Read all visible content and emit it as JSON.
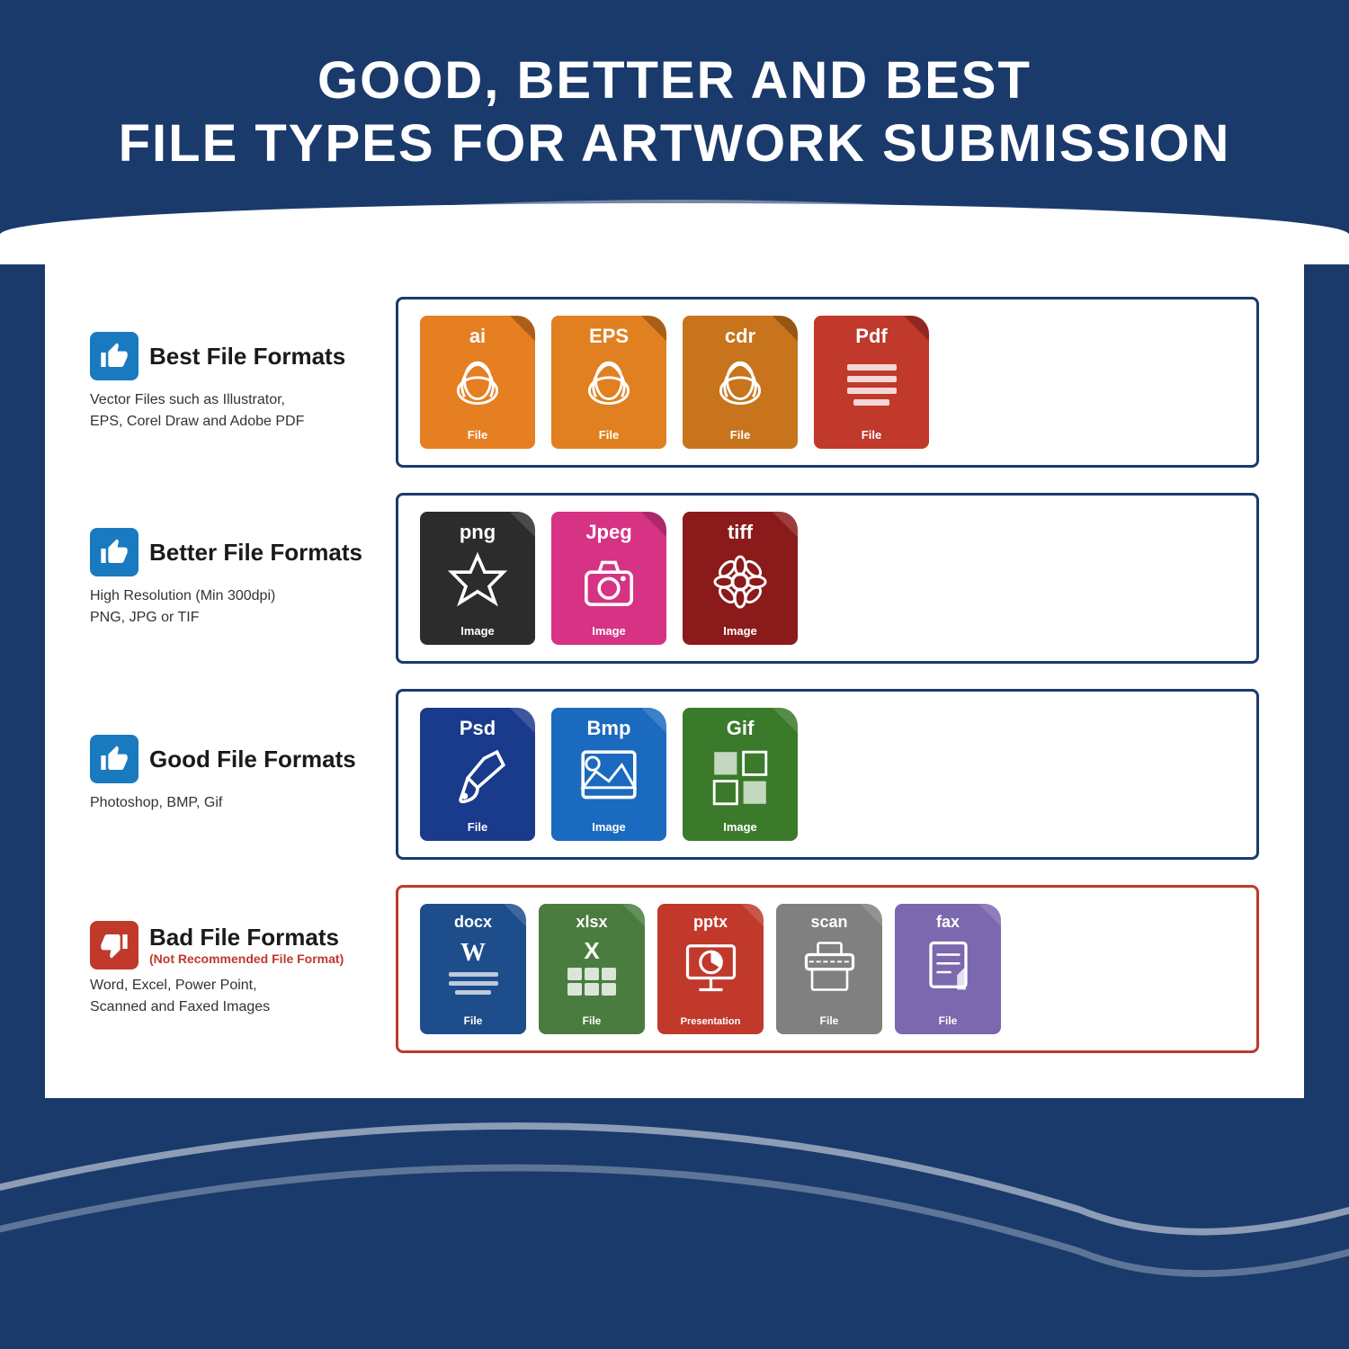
{
  "header": {
    "line1": "GOOD, BETTER AND BEST",
    "line2": "FILE TYPES FOR ARTWORK SUBMISSION"
  },
  "rows": [
    {
      "id": "best",
      "thumb": "up",
      "title": "Best File Formats",
      "subtitle": null,
      "description": "Vector Files such as Illustrator,\nEPS, Corel Draw and Adobe PDF",
      "border_color": "#1a3a6b",
      "files": [
        {
          "ext": "ai",
          "label": "File",
          "color": "#e67e22",
          "graphic": "pen",
          "label_bottom": "File"
        },
        {
          "ext": "EPS",
          "label": "File",
          "color": "#e08020",
          "graphic": "pen",
          "label_bottom": "File"
        },
        {
          "ext": "cdr",
          "label": "File",
          "color": "#c8741c",
          "graphic": "pen",
          "label_bottom": "File"
        },
        {
          "ext": "Pdf",
          "label": "File",
          "color": "#c0392b",
          "graphic": "pdf",
          "label_bottom": "File"
        }
      ]
    },
    {
      "id": "better",
      "thumb": "up",
      "title": "Better File Formats",
      "subtitle": null,
      "description": "High Resolution (Min 300dpi)\nPNG, JPG or TIF",
      "border_color": "#1a3a6b",
      "files": [
        {
          "ext": "png",
          "label": "Image",
          "color": "#2c2c2c",
          "graphic": "star",
          "label_bottom": "Image"
        },
        {
          "ext": "Jpeg",
          "label": "Image",
          "color": "#d63384",
          "graphic": "camera",
          "label_bottom": "Image"
        },
        {
          "ext": "tiff",
          "label": "Image",
          "color": "#8b1a1a",
          "graphic": "flower",
          "label_bottom": "Image"
        }
      ]
    },
    {
      "id": "good",
      "thumb": "up",
      "title": "Good File Formats",
      "subtitle": null,
      "description": "Photoshop, BMP, Gif",
      "border_color": "#1a3a6b",
      "files": [
        {
          "ext": "Psd",
          "label": "File",
          "color": "#1a3a8b",
          "graphic": "brush",
          "label_bottom": "File"
        },
        {
          "ext": "Bmp",
          "label": "Image",
          "color": "#1a6abf",
          "graphic": "landscape",
          "label_bottom": "Image"
        },
        {
          "ext": "Gif",
          "label": "Image",
          "color": "#3a7a2a",
          "graphic": "grid",
          "label_bottom": "Image"
        }
      ]
    },
    {
      "id": "bad",
      "thumb": "down",
      "title": "Bad File Formats",
      "subtitle": "(Not Recommended File Format)",
      "description": "Word, Excel, Power Point,\nScanned and Faxed Images",
      "border_color": "#c0392b",
      "files": [
        {
          "ext": "docx",
          "label": "File",
          "color": "#1e4d8c",
          "graphic": "word",
          "label_bottom": "File"
        },
        {
          "ext": "xlsx",
          "label": "File",
          "color": "#4a7c3f",
          "graphic": "excel",
          "label_bottom": "File"
        },
        {
          "ext": "pptx",
          "label": "Presentation",
          "color": "#c0392b",
          "graphic": "ppt",
          "label_bottom": "Presentation"
        },
        {
          "ext": "scan",
          "label": "File",
          "color": "#808080",
          "graphic": "scan",
          "label_bottom": "File"
        },
        {
          "ext": "fax",
          "label": "File",
          "color": "#7b68ae",
          "graphic": "fax",
          "label_bottom": "File"
        }
      ]
    }
  ]
}
